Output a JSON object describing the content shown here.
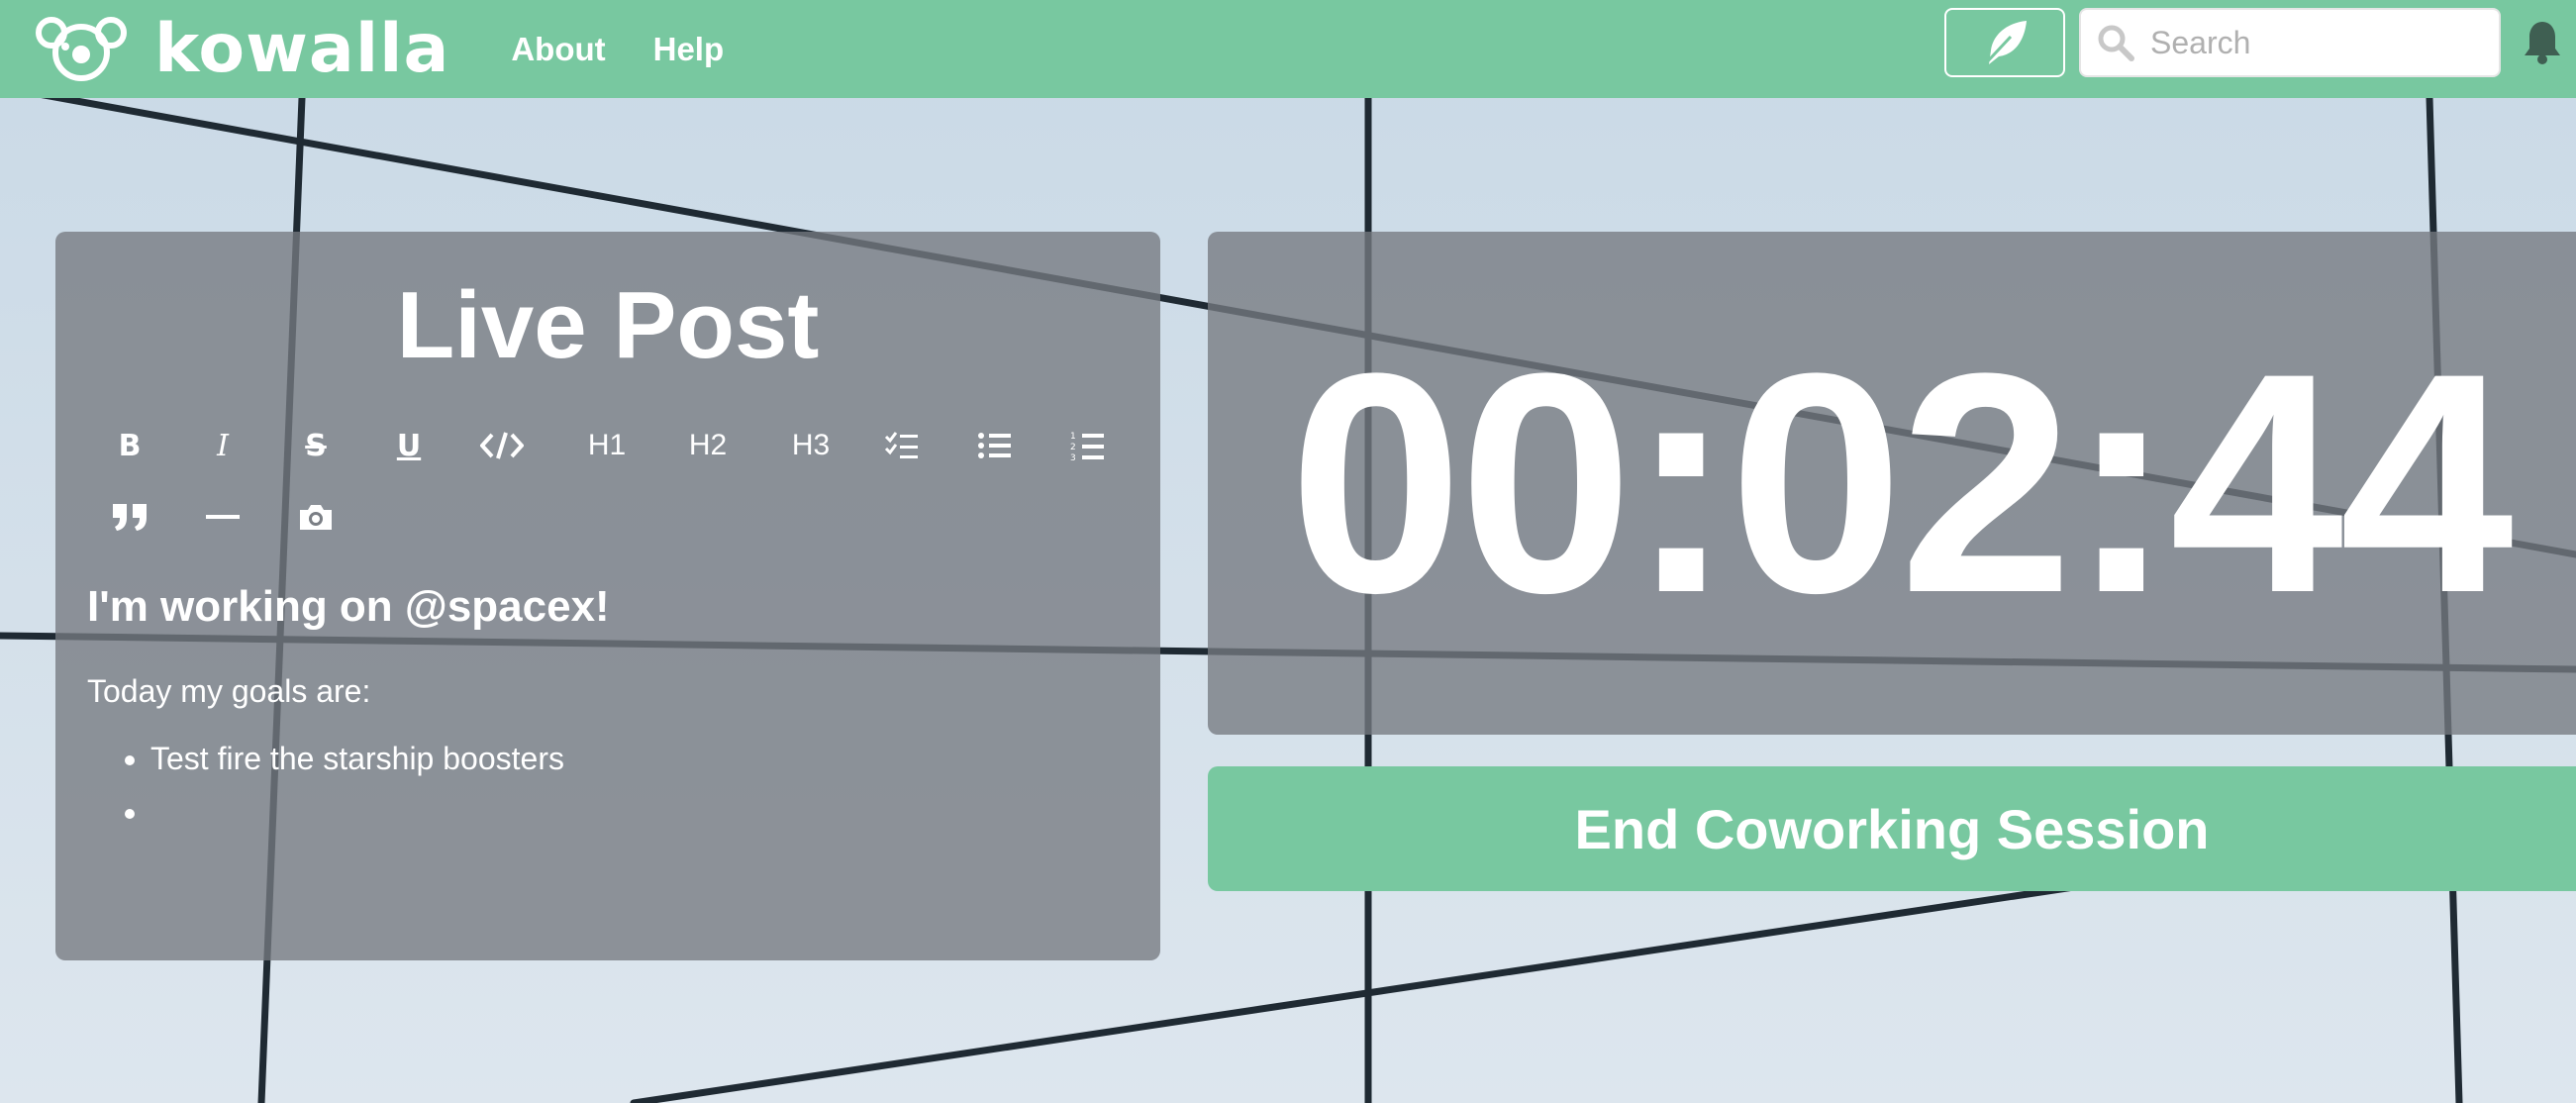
{
  "brand": {
    "name": "kowalla",
    "color": "#78c8a0"
  },
  "nav": {
    "links": [
      "About",
      "Help"
    ]
  },
  "header_actions": {
    "post_icon": "feather-icon",
    "search_placeholder": "Search",
    "search_icon": "search-icon",
    "notifications_icon": "bell-icon"
  },
  "live_post": {
    "title": "Live Post",
    "toolbar": {
      "bold": "B",
      "italic": "I",
      "strike": "S",
      "underline": "U",
      "code_icon": "code-icon",
      "h1": "H1",
      "h2": "H2",
      "h3": "H3",
      "checklist_icon": "checklist-icon",
      "bullet_list_icon": "bullet-list-icon",
      "numbered_list_icon": "numbered-list-icon",
      "quote_icon": "quote-icon",
      "rule_icon": "horizontal-rule-icon",
      "image_icon": "camera-icon"
    },
    "content": {
      "heading": "I'm working on @spacex!",
      "paragraph": "Today my goals are:",
      "goals": [
        "Test fire the starship boosters",
        ""
      ]
    }
  },
  "session": {
    "timer": "00:02:44",
    "end_button": "End Coworking Session"
  }
}
